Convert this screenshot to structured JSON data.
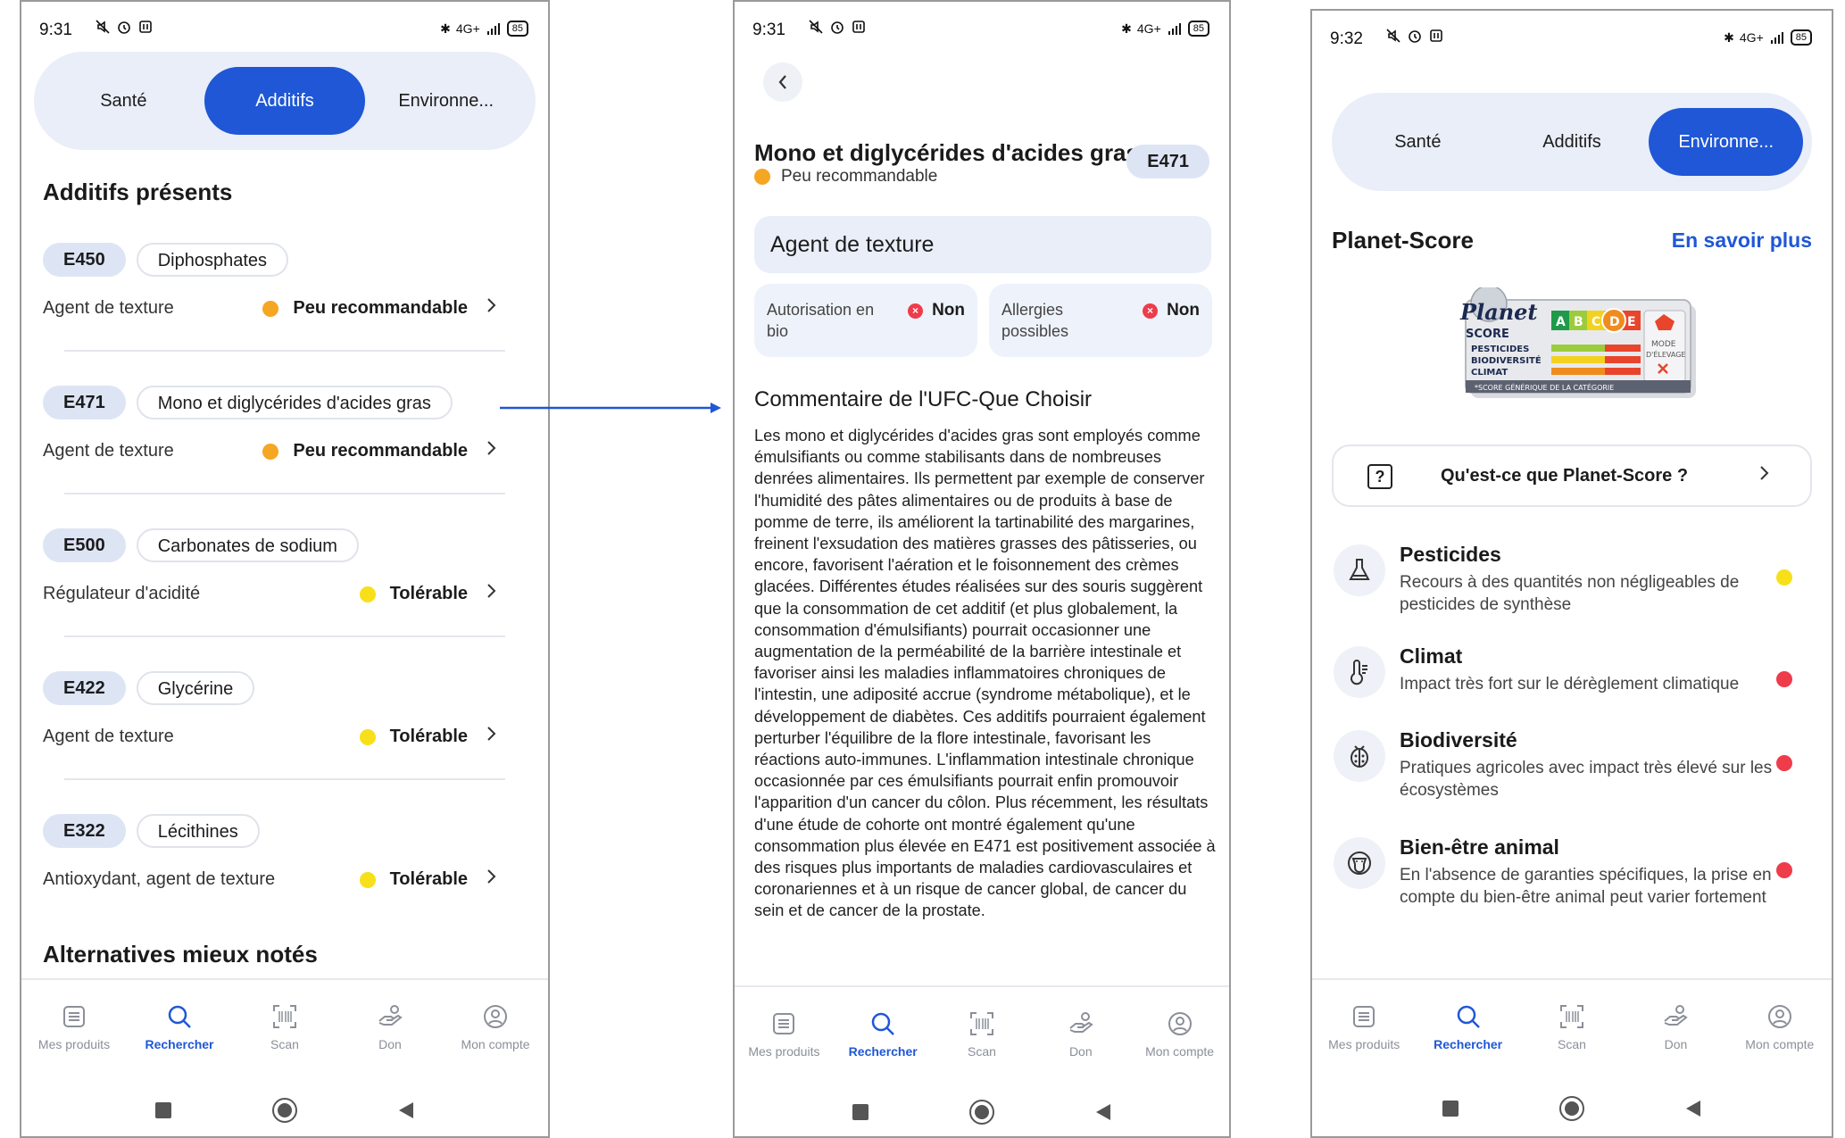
{
  "colors": {
    "accent": "#1f57d6",
    "orange": "#f5a623",
    "yellow": "#f7e01a",
    "red": "#ee3c4a"
  },
  "status": {
    "time1": "9:31",
    "time2": "9:31",
    "time3": "9:32",
    "battery": "85",
    "network": "4G+"
  },
  "tabs": [
    "Santé",
    "Additifs",
    "Environne..."
  ],
  "screen1": {
    "active_tab": "Additifs",
    "heading": "Additifs présents",
    "additives": [
      {
        "code": "E450",
        "name": "Diphosphates",
        "function": "Agent de texture",
        "rating": "Peu recommandable",
        "rating_color": "orange"
      },
      {
        "code": "E471",
        "name": "Mono et diglycérides d'acides gras",
        "function": "Agent de texture",
        "rating": "Peu recommandable",
        "rating_color": "orange"
      },
      {
        "code": "E500",
        "name": "Carbonates de sodium",
        "function": "Régulateur d'acidité",
        "rating": "Tolérable",
        "rating_color": "yellow"
      },
      {
        "code": "E422",
        "name": "Glycérine",
        "function": "Agent de texture",
        "rating": "Tolérable",
        "rating_color": "yellow"
      },
      {
        "code": "E322",
        "name": "Lécithines",
        "function": "Antioxydant, agent de texture",
        "rating": "Tolérable",
        "rating_color": "yellow"
      }
    ],
    "alternatives_heading": "Alternatives mieux notés"
  },
  "screen2": {
    "title": "Mono et diglycérides d'acides gras",
    "code": "E471",
    "rating": "Peu recommandable",
    "function": "Agent de texture",
    "bio_label": "Autorisation en bio",
    "bio_value": "Non",
    "allergy_label": "Allergies possibles",
    "allergy_value": "Non",
    "comment_heading": "Commentaire de l'UFC-Que Choisir",
    "comment": "Les mono et diglycérides d'acides gras sont employés comme émulsifiants ou comme stabilisants dans de nombreuses denrées alimentaires. Ils permettent par exemple de conserver l'humidité des pâtes alimentaires ou de produits à base de pomme de terre, ils améliorent la tartinabilité des margarines, freinent l'exsudation des matières grasses des pâtisseries, ou encore, favorisent l'aération et le foisonnement des crèmes glacées. Différentes études réalisées sur des souris suggèrent que la consommation de cet additif (et plus globalement, la consommation d'émulsifiants) pourrait occasionner une augmentation de la perméabilité de la barrière intestinale et favoriser ainsi les maladies inflammatoires chroniques de l'intestin, une adiposité accrue (syndrome métabolique), et le développement de diabètes. Ces additifs pourraient également perturber l'équilibre de la flore intestinale, favorisant les réactions auto-immunes. L'inflammation intestinale chronique occasionnée par ces émulsifiants pourrait enfin promouvoir l'apparition d'un cancer du côlon. Plus récemment, les résultats d'une étude de cohorte ont montré également qu'une consommation plus élevée en E471 est positivement associée à des risques plus importants de maladies cardiovasculaires et coronariennes et à un risque de cancer global, de cancer du sein et de cancer de la prostate."
  },
  "screen3": {
    "active_tab": "Environne...",
    "heading": "Planet-Score",
    "learn_more": "En savoir plus",
    "logo": {
      "brand": "Planet",
      "brand2": "SCORE",
      "letters": [
        "A",
        "B",
        "C",
        "D",
        "E"
      ],
      "rows": [
        "PESTICIDES",
        "BIODIVERSITÉ",
        "CLIMAT"
      ],
      "mode": "MODE",
      "mode2": "D'ÉLEVAGE",
      "footer": "*SCORE GÉNÉRIQUE DE LA CATÉGORIE"
    },
    "question": "Qu'est-ce que Planet-Score ?",
    "criteria": [
      {
        "icon": "flask-icon",
        "title": "Pesticides",
        "desc": "Recours à des quantités non négligeables de pesticides de synthèse",
        "color": "yellow"
      },
      {
        "icon": "thermometer-icon",
        "title": "Climat",
        "desc": "Impact très fort sur le dérèglement climatique",
        "color": "red"
      },
      {
        "icon": "ladybug-icon",
        "title": "Biodiversité",
        "desc": "Pratiques agricoles avec impact très élevé sur les écosystèmes",
        "color": "red"
      },
      {
        "icon": "cow-icon",
        "title": "Bien-être animal",
        "desc": "En l'absence de garanties spécifiques, la prise en compte du bien-être animal peut varier fortement",
        "color": "red"
      }
    ]
  },
  "nav": [
    {
      "label": "Mes produits",
      "icon": "list-icon"
    },
    {
      "label": "Rechercher",
      "icon": "search-icon",
      "active": true
    },
    {
      "label": "Scan",
      "icon": "barcode-scan-icon"
    },
    {
      "label": "Don",
      "icon": "donate-hand-icon"
    },
    {
      "label": "Mon compte",
      "icon": "account-icon"
    }
  ]
}
